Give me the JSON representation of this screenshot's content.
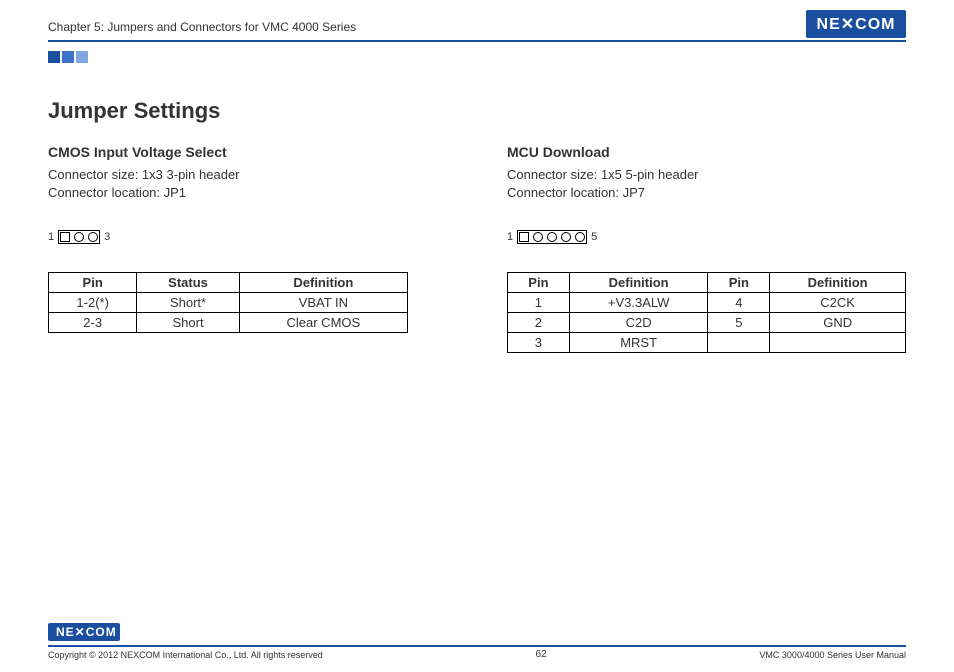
{
  "header": {
    "chapter": "Chapter 5: Jumpers and Connectors for VMC 4000 Series",
    "logo_text": "NEXCOM"
  },
  "page_title": "Jumper Settings",
  "left": {
    "title": "CMOS Input Voltage Select",
    "conn_size": "Connector size: 1x3 3-pin header",
    "conn_loc": "Connector location: JP1",
    "diagram": {
      "left_label": "1",
      "right_label": "3",
      "pins": 3
    },
    "table": {
      "headers": [
        "Pin",
        "Status",
        "Definition"
      ],
      "rows": [
        [
          "1-2(*)",
          "Short*",
          "VBAT IN"
        ],
        [
          "2-3",
          "Short",
          "Clear CMOS"
        ]
      ]
    }
  },
  "right": {
    "title": "MCU Download",
    "conn_size": "Connector size: 1x5 5-pin header",
    "conn_loc": "Connector location: JP7",
    "diagram": {
      "left_label": "1",
      "right_label": "5",
      "pins": 5
    },
    "table": {
      "headers": [
        "Pin",
        "Definition",
        "Pin",
        "Definition"
      ],
      "rows": [
        [
          "1",
          "+V3.3ALW",
          "4",
          "C2CK"
        ],
        [
          "2",
          "C2D",
          "5",
          "GND"
        ],
        [
          "3",
          "MRST",
          "",
          ""
        ]
      ]
    }
  },
  "footer": {
    "logo_text": "NEXCOM",
    "copyright": "Copyright © 2012 NEXCOM International Co., Ltd. All rights reserved",
    "page_num": "62",
    "doc_title": "VMC 3000/4000 Series User Manual"
  }
}
